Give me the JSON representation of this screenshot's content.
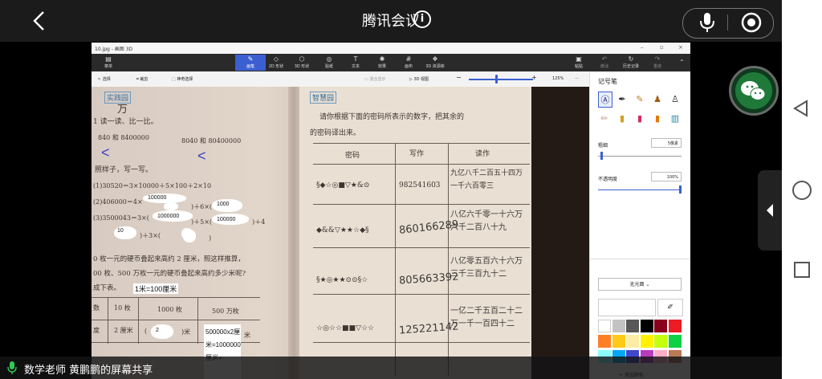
{
  "top_bar": {
    "meeting_title": "腾讯会议",
    "info_glyph": "i"
  },
  "share_banner": {
    "text": "数学老师 黄鹏鹏的屏幕共享"
  },
  "window": {
    "title": "10.jpg - 画图 3D",
    "ribbon": [
      {
        "label": "菜单",
        "icon": "menu-icon"
      },
      {
        "label": "画笔",
        "icon": "brush-icon"
      },
      {
        "label": "2D 形状",
        "icon": "shapes-2d-icon"
      },
      {
        "label": "3D 形状",
        "icon": "shapes-3d-icon"
      },
      {
        "label": "贴纸",
        "icon": "sticker-icon"
      },
      {
        "label": "文本",
        "icon": "text-icon"
      },
      {
        "label": "效果",
        "icon": "effects-icon"
      },
      {
        "label": "画布",
        "icon": "canvas-icon"
      },
      {
        "label": "3D 资源库",
        "icon": "library-icon"
      },
      {
        "label": "粘贴",
        "icon": "paste-icon"
      },
      {
        "label": "撤消",
        "icon": "undo-icon"
      },
      {
        "label": "历史记录",
        "icon": "history-icon"
      },
      {
        "label": "重做",
        "icon": "redo-icon"
      }
    ],
    "subbar": {
      "select": "选择",
      "crop": "裁剪",
      "magic_select": "神奇选择",
      "clear_floor": "混合显示",
      "view_3d": "3D 视图",
      "zoom": "125%",
      "more": "···"
    },
    "panel": {
      "title": "记号笔",
      "thickness_label": "粗细",
      "thickness_value": "5像素",
      "opacity_label": "不透明度",
      "opacity_value": "100%",
      "finish": "无光面",
      "add_color": "+ 添加颜色"
    },
    "colors": [
      "#ffffff",
      "#c3c3c3",
      "#585858",
      "#000000",
      "#88001b",
      "#ec1c24",
      "#ff7f27",
      "#ffca18",
      "#fdeca6",
      "#fff200",
      "#c4ff0e",
      "#0ed145",
      "#8cfffb",
      "#00a8f3",
      "#3f48cc",
      "#b83dba",
      "#ffaec8",
      "#b97a56"
    ]
  },
  "worksheet": {
    "left": {
      "section_tag": "实践园",
      "heading_wan": "万",
      "q1": "1 读一读、比一比。",
      "q1_a": "840 和 8400000",
      "q1_b": "8040 和 80400000",
      "q2": "照样子，写一写。",
      "q2_1": "(1)30520＝3×10000＋5×100＋2×10",
      "q2_2": "(2)406000＝4×",
      "q2_2_mid": ")＋6×(",
      "q2_3": "(3)3500043＝3×(",
      "q2_3_mid": ")＋5×(",
      "q2_3_end": ")＋4",
      "q2_3b": ")＋3×(",
      "q2_3b_end": ")",
      "ans_100000": "100000",
      "ans_1000": "1000",
      "ans_1000000": "1000000",
      "ans_100000b": "100000",
      "ans_10": "10",
      "q3_a": "0 枚一元的硬币叠起来高约 2 厘米，照这样推算，",
      "q3_b": "00 枚、500 万枚一元的硬币叠起来高约多少米呢?",
      "q3_c": "成下表。",
      "q3_note": "1米=100厘米",
      "table_h1": "数",
      "table_h2": "10 枚",
      "table_h3": "1000 枚",
      "table_h4": "500 万枚",
      "table_r1": "度",
      "table_r2": "2 厘米",
      "table_r3": "(",
      "table_r3_ans": "2",
      "table_r3_end": ")米",
      "table_r4_ans": "500000x2厘米=1000000厘米=",
      "table_r4_end": "米"
    },
    "right": {
      "section_tag": "智慧园",
      "intro_a": "请你根据下面的密码所表示的数字，把其余的",
      "intro_b": "的密码译出来。",
      "col_code": "密码",
      "col_write": "写作",
      "col_read": "读作",
      "rows": [
        {
          "code": "§◆☆◎■▽★&⊙",
          "write": "982541603",
          "read": "九亿八千二百五十四万一千六百零三"
        },
        {
          "code": "◆&&▽★★☆◆§",
          "write": "860166289",
          "read": "八亿六千零一十六万六千二百八十九"
        },
        {
          "code": "§★◎★★⊙⊙§☆",
          "write": "805663392",
          "read": "八亿零五百六十六万三千三百九十二"
        },
        {
          "code": "☆◎☆☆■■▽☆☆",
          "write": "125221142",
          "read": "一亿二千五百二十二万一千一百四十二"
        }
      ]
    },
    "annotations": [
      "<",
      "<"
    ]
  }
}
